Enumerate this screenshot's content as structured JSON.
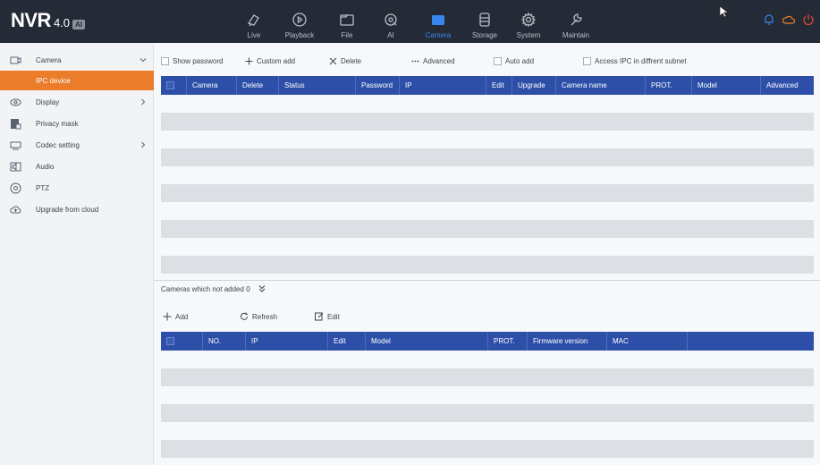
{
  "app": {
    "logo": "NVR",
    "version": "4.0",
    "badge": "AI"
  },
  "nav": [
    {
      "label": "Live",
      "icon": "live-icon",
      "active": false
    },
    {
      "label": "Playback",
      "icon": "playback-icon",
      "active": false
    },
    {
      "label": "File",
      "icon": "folder-icon",
      "active": false
    },
    {
      "label": "AI",
      "icon": "ai-icon",
      "active": false
    },
    {
      "label": "Camera",
      "icon": "camera-icon",
      "active": true
    },
    {
      "label": "Storage",
      "icon": "storage-icon",
      "active": false
    },
    {
      "label": "System",
      "icon": "gear-icon",
      "active": false
    },
    {
      "label": "Maintain",
      "icon": "wrench-icon",
      "active": false
    }
  ],
  "colors": {
    "topbar": "#242a36",
    "accent": "#3a86f0",
    "sidebar_active": "#ea7c2a",
    "table_header": "#2d4fa8"
  },
  "sidebar": [
    {
      "label": "Camera",
      "icon": "camera-icon",
      "expanded": true
    },
    {
      "label": "IPC device",
      "icon": "",
      "active": true
    },
    {
      "label": "Display",
      "icon": "display-icon",
      "has_arrow": true
    },
    {
      "label": "Privacy mask",
      "icon": "privacy-mask-icon"
    },
    {
      "label": "Codec setting",
      "icon": "codec-icon",
      "has_arrow": true
    },
    {
      "label": "Audio",
      "icon": "audio-icon"
    },
    {
      "label": "PTZ",
      "icon": "ptz-icon"
    },
    {
      "label": "Upgrade from cloud",
      "icon": "cloud-upgrade-icon"
    }
  ],
  "toolbar": {
    "show_password": "Show password",
    "custom_add": "Custom add",
    "delete": "Delete",
    "advanced": "Advanced",
    "auto_add": "Auto add",
    "access_ipc": "Access IPC in diffrent subnet"
  },
  "table1": {
    "columns": [
      "Camera",
      "Delete",
      "Status",
      "Password",
      "IP",
      "Edit",
      "Upgrade",
      "Camera name",
      "PROT.",
      "Model",
      "Advanced"
    ],
    "rows": []
  },
  "section2": {
    "label": "Cameras which not added",
    "count": "0"
  },
  "toolbar2": {
    "add": "Add",
    "refresh": "Refresh",
    "edit": "Edit"
  },
  "table2": {
    "columns": [
      "NO.",
      "IP",
      "Edit",
      "Model",
      "PROT.",
      "Firmware version",
      "MAC"
    ],
    "rows": []
  }
}
